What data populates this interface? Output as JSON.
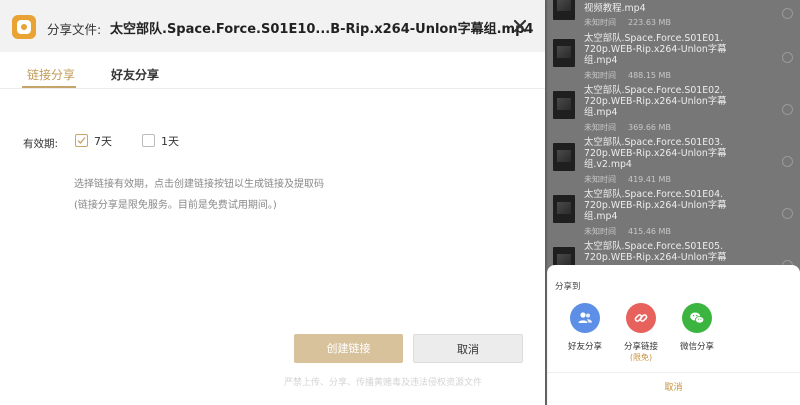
{
  "dialog": {
    "header_label": "分享文件:",
    "file_title": "太空部队.Space.Force.S01E10...B-Rip.x264-Unlon字幕组.mp4",
    "tabs": [
      {
        "label": "链接分享",
        "active": true
      },
      {
        "label": "好友分享",
        "active": false
      }
    ],
    "validity": {
      "label": "有效期:",
      "options": [
        {
          "label": "7天",
          "checked": true
        },
        {
          "label": "1天",
          "checked": false
        }
      ]
    },
    "hint_line1": "选择链接有效期，点击创建链接按钮以生成链接及提取码",
    "hint_line2": "(链接分享是限免服务。目前是免费试用期间。)",
    "create_button": "创建链接",
    "cancel_button": "取消",
    "footer_note": "严禁上传、分享、传播黄赌毒及违法侵权资源文件"
  },
  "file_list": [
    {
      "name_lines": [
        "视频教程.mp4"
      ],
      "time": "未知时间",
      "size": "223.63 MB"
    },
    {
      "name_lines": [
        "太空部队.Space.Force.S01E01.",
        "720p.WEB-Rip.x264-Unlon字幕",
        "组.mp4"
      ],
      "time": "未知时间",
      "size": "488.15 MB"
    },
    {
      "name_lines": [
        "太空部队.Space.Force.S01E02.",
        "720p.WEB-Rip.x264-Unlon字幕",
        "组.mp4"
      ],
      "time": "未知时间",
      "size": "369.66 MB"
    },
    {
      "name_lines": [
        "太空部队.Space.Force.S01E03.",
        "720p.WEB-Rip.x264-Unlon字幕",
        "组.v2.mp4"
      ],
      "time": "未知时间",
      "size": "419.41 MB"
    },
    {
      "name_lines": [
        "太空部队.Space.Force.S01E04.",
        "720p.WEB-Rip.x264-Unlon字幕",
        "组.mp4"
      ],
      "time": "未知时间",
      "size": "415.46 MB"
    },
    {
      "name_lines": [
        "太空部队.Space.Force.S01E05.",
        "720p.WEB-Rip.x264-Unlon字幕"
      ],
      "time": "",
      "size": ""
    }
  ],
  "share_sheet": {
    "title": "分享到",
    "items": [
      {
        "label": "好友分享",
        "sub": ""
      },
      {
        "label": "分享链接",
        "sub": "(限免)"
      },
      {
        "label": "微信分享",
        "sub": ""
      }
    ],
    "cancel": "取消"
  },
  "colors": {
    "accent_gold": "#c6a56b",
    "create_button_bg": "#d8c29c",
    "friend_icon_bg": "#5d8fe6",
    "link_icon_bg": "#e7625c",
    "wechat_icon_bg": "#3bb53f",
    "app_icon": "#e8a334"
  },
  "icons": {
    "app": "app-logo-icon",
    "close": "close-icon",
    "check": "checkmark-icon",
    "friend": "friends-icon",
    "link": "link-icon",
    "wechat": "wechat-icon"
  }
}
